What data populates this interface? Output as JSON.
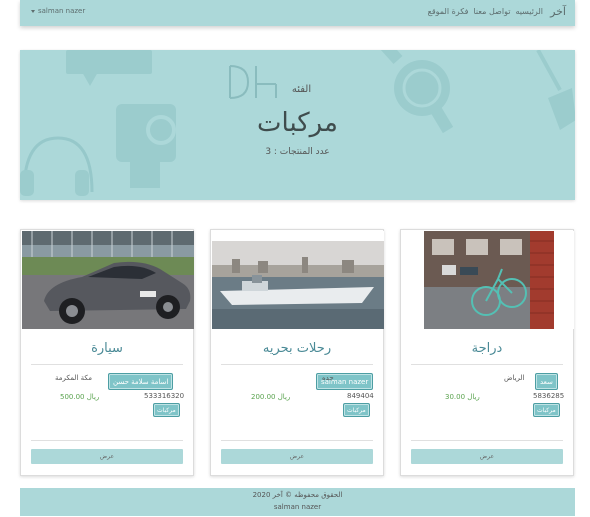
{
  "nav": {
    "brand": "آخر",
    "links": [
      "الرئيسيه",
      "تواصل معنا",
      "فكرة الموقع"
    ],
    "user": "salman nazer"
  },
  "hero": {
    "label": "الفئه",
    "title": "مركبات",
    "count_text": "عدد المنتجات : 3"
  },
  "cards": [
    {
      "title": "سيارة",
      "owner": "اسامة سلامة حسن",
      "city": "مكة المكرمة",
      "phone": "533316320",
      "price": "500.00 ريال",
      "category": "مركبات",
      "view": "عرض"
    },
    {
      "title": "رحلات بحريه",
      "owner": "salman nazer",
      "city": "جده",
      "phone": "849404",
      "price": "200.00 ريال",
      "category": "مركبات",
      "view": "عرض"
    },
    {
      "title": "دراجة",
      "owner": "سعد",
      "city": "الرياض",
      "phone": "5836285",
      "price": "30.00 ريال",
      "category": "مركبات",
      "view": "عرض"
    }
  ],
  "footer": {
    "line1": "الحقوق محفوظه © آخر 2020",
    "line2": "salman nazer"
  },
  "colors": {
    "accent": "#acd8d9",
    "button": "#7fc4c8",
    "title": "#4a8a96",
    "price": "#5aa34f"
  }
}
